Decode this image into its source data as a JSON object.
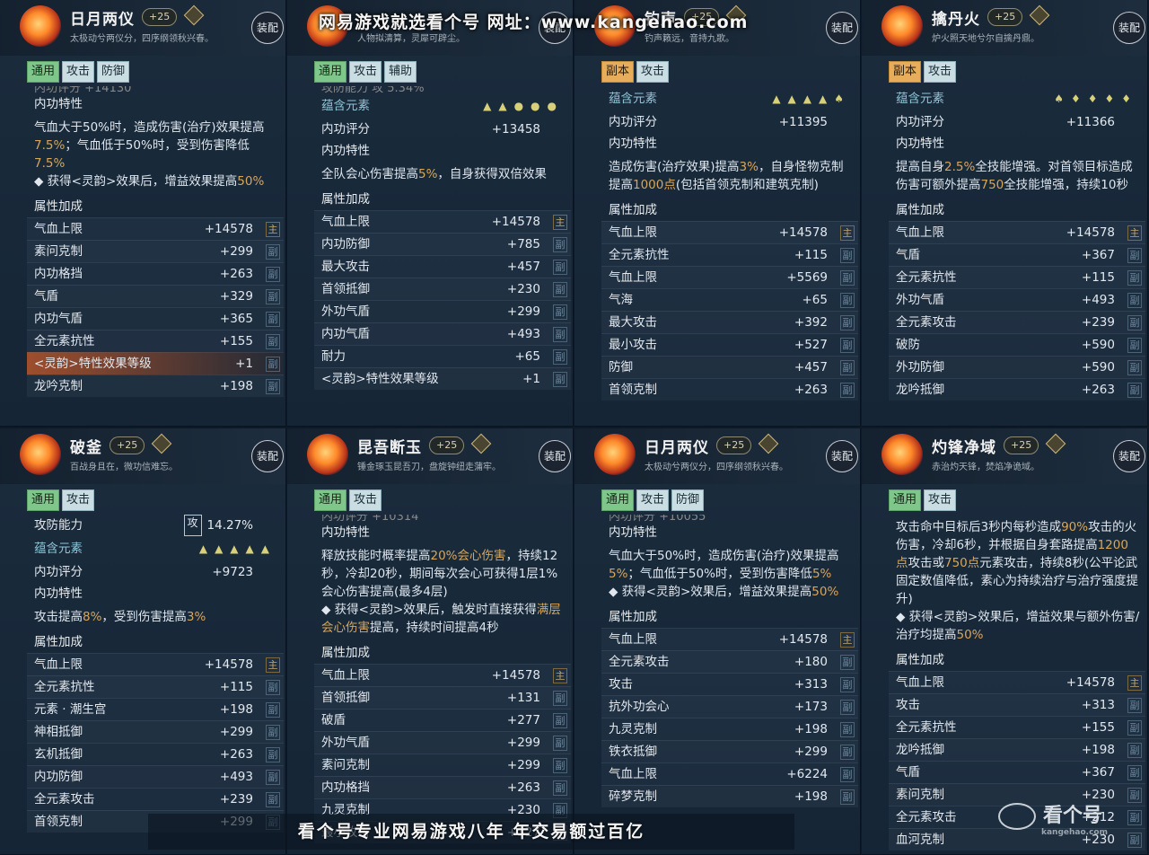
{
  "watermark_top": "网易游戏就选看个号  网址：www.kangehao.com",
  "watermark_bottom": "看个号专业网易游戏八年  年交易额过百亿",
  "watermark_logo": "看个号",
  "watermark_logo_url": "kangehao.com",
  "panels": [
    {
      "name": "日月两仪",
      "level": "+25",
      "desc": "太极动兮两仪分，四序纲领秋兴春。",
      "equip": "装配",
      "tags": [
        [
          "通用",
          "g"
        ],
        [
          "攻击",
          ""
        ],
        [
          "防御",
          ""
        ]
      ],
      "clip": "内功评分                +14130",
      "sections": [
        {
          "t": "sec",
          "k": "内功特性"
        },
        {
          "t": "txt",
          "html": "气血大于50%时，造成伤害(治疗)效果提高<span class='hl'>7.5%</span>；气血低于50%时，受到伤害降低<span class='hl'>7.5%</span><br>◆ 获得&lt;灵韵&gt;效果后，增益效果提高<span class='hl'>50%</span>"
        },
        {
          "t": "sec",
          "k": "属性加成"
        }
      ],
      "attrs": [
        [
          "气血上限",
          "+14578",
          "主"
        ],
        [
          "素问克制",
          "+299",
          "副"
        ],
        [
          "内功格挡",
          "+263",
          "副"
        ],
        [
          "气盾",
          "+329",
          "副"
        ],
        [
          "内功气盾",
          "+365",
          "副"
        ],
        [
          "全元素抗性",
          "+155",
          "副"
        ],
        [
          "<灵韵>特性效果等级",
          "+1",
          "副"
        ],
        [
          "龙吟克制",
          "+198",
          "副"
        ]
      ]
    },
    {
      "name": "",
      "level": "",
      "desc": "人物拟清算，灵犀可辟尘。",
      "equip": "装配",
      "tags": [
        [
          "通用",
          "g"
        ],
        [
          "攻击",
          ""
        ],
        [
          "辅助",
          ""
        ]
      ],
      "clip": "攻防能力           攻 5.34%",
      "elem": {
        "k": "蕴含元素",
        "ic": "▲▲●●●"
      },
      "sections": [
        {
          "t": "row",
          "k": "内功评分",
          "v": "+13458"
        },
        {
          "t": "sec",
          "k": "内功特性"
        },
        {
          "t": "txt",
          "html": "全队会心伤害提高<span class='hl'>5%</span>，自身获得双倍效果"
        },
        {
          "t": "sec",
          "k": "属性加成"
        }
      ],
      "attrs": [
        [
          "气血上限",
          "+14578",
          "主"
        ],
        [
          "内功防御",
          "+785",
          "副"
        ],
        [
          "最大攻击",
          "+457",
          "副"
        ],
        [
          "首领抵御",
          "+230",
          "副"
        ],
        [
          "外功气盾",
          "+299",
          "副"
        ],
        [
          "内功气盾",
          "+493",
          "副"
        ],
        [
          "耐力",
          "+65",
          "副"
        ],
        [
          "<灵韵>特性效果等级",
          "+1",
          "副"
        ]
      ]
    },
    {
      "name": "钓声",
      "level": "+25",
      "desc": "钓声籁远，音持九歌。",
      "equip": "装配",
      "tags": [
        [
          "副本",
          "o"
        ],
        [
          "攻击",
          ""
        ]
      ],
      "clip": "",
      "elem": {
        "k": "蕴含元素",
        "ic": "▲▲▲▲♠"
      },
      "sections": [
        {
          "t": "row",
          "k": "内功评分",
          "v": "+11395"
        },
        {
          "t": "sec",
          "k": "内功特性"
        },
        {
          "t": "txt",
          "html": "造成伤害(治疗效果)提高<span class='hl'>3%</span>，自身怪物克制提高<span class='hl'>1000点</span>(包括首领克制和建筑克制)"
        },
        {
          "t": "sec",
          "k": "属性加成"
        }
      ],
      "attrs": [
        [
          "气血上限",
          "+14578",
          "主"
        ],
        [
          "全元素抗性",
          "+115",
          "副"
        ],
        [
          "气血上限",
          "+5569",
          "副"
        ],
        [
          "气海",
          "+65",
          "副"
        ],
        [
          "最大攻击",
          "+392",
          "副"
        ],
        [
          "最小攻击",
          "+527",
          "副"
        ],
        [
          "防御",
          "+457",
          "副"
        ],
        [
          "首领克制",
          "+263",
          "副"
        ]
      ]
    },
    {
      "name": "擒丹火",
      "level": "+25",
      "desc": "炉火照天地兮尔自擒丹鼎。",
      "equip": "装配",
      "tags": [
        [
          "副本",
          "o"
        ],
        [
          "攻击",
          ""
        ]
      ],
      "clip": "",
      "elem": {
        "k": "蕴含元素",
        "ic": "♠♦♦♦♦"
      },
      "sections": [
        {
          "t": "row",
          "k": "内功评分",
          "v": "+11366"
        },
        {
          "t": "sec",
          "k": "内功特性"
        },
        {
          "t": "txt",
          "html": "提高自身<span class='hl'>2.5%</span>全技能增强。对首领目标造成伤害可额外提高<span class='hl'>750</span>全技能增强，持续10秒"
        },
        {
          "t": "sec",
          "k": "属性加成"
        }
      ],
      "attrs": [
        [
          "气血上限",
          "+14578",
          "主"
        ],
        [
          "气盾",
          "+367",
          "副"
        ],
        [
          "全元素抗性",
          "+115",
          "副"
        ],
        [
          "外功气盾",
          "+493",
          "副"
        ],
        [
          "全元素攻击",
          "+239",
          "副"
        ],
        [
          "破防",
          "+590",
          "副"
        ],
        [
          "外功防御",
          "+590",
          "副"
        ],
        [
          "龙吟抵御",
          "+263",
          "副"
        ]
      ]
    },
    {
      "name": "破釜",
      "level": "+25",
      "desc": "百战身且在，微功信难忘。",
      "equip": "装配",
      "tags": [
        [
          "通用",
          "g"
        ],
        [
          "攻击",
          ""
        ]
      ],
      "clip": "",
      "atk": {
        "k": "攻防能力",
        "badge": "攻",
        "v": "14.27%"
      },
      "elem": {
        "k": "蕴含元素",
        "ic": "▲▲▲▲▲"
      },
      "sections": [
        {
          "t": "row",
          "k": "内功评分",
          "v": "+9723"
        },
        {
          "t": "sec",
          "k": "内功特性"
        },
        {
          "t": "txt",
          "html": "攻击提高<span class='hl'>8%</span>，受到伤害提高<span class='hl'>3%</span>"
        },
        {
          "t": "sec",
          "k": "属性加成"
        }
      ],
      "attrs": [
        [
          "气血上限",
          "+14578",
          "主"
        ],
        [
          "全元素抗性",
          "+115",
          "副"
        ],
        [
          "元素 · 潮生宫",
          "+198",
          "副"
        ],
        [
          "神相抵御",
          "+299",
          "副"
        ],
        [
          "玄机抵御",
          "+263",
          "副"
        ],
        [
          "内功防御",
          "+493",
          "副"
        ],
        [
          "全元素攻击",
          "+239",
          "副"
        ],
        [
          "首领克制",
          "+299",
          "副"
        ]
      ]
    },
    {
      "name": "昆吾断玉",
      "level": "+25",
      "desc": "锤金琢玉昆吾刀，盘旋钟纽走蒲牢。",
      "equip": "装配",
      "tags": [
        [
          "通用",
          "g"
        ],
        [
          "攻击",
          ""
        ]
      ],
      "clip": "内功评分                +10314",
      "sections": [
        {
          "t": "sec",
          "k": "内功特性"
        },
        {
          "t": "txt",
          "html": "释放技能时概率提高<span class='hl'>20%会心伤害</span>，持续12秒，冷却20秒，期间每次会心可获得1层1%会心伤害提高(最多4层)<br>◆ 获得&lt;灵韵&gt;效果后，触发时直接获得<span class='hl'>满层会心伤害</span>提高，持续时间提高4秒"
        },
        {
          "t": "sec",
          "k": "属性加成"
        }
      ],
      "attrs": [
        [
          "气血上限",
          "+14578",
          "主"
        ],
        [
          "首领抵御",
          "+131",
          "副"
        ],
        [
          "破盾",
          "+277",
          "副"
        ],
        [
          "外功气盾",
          "+299",
          "副"
        ],
        [
          "素问克制",
          "+299",
          "副"
        ],
        [
          "内功格挡",
          "+263",
          "副"
        ],
        [
          "九灵克制",
          "+230",
          "副"
        ],
        [
          "最小攻击",
          "+327",
          "副"
        ]
      ]
    },
    {
      "name": "日月两仪",
      "level": "+25",
      "desc": "太极动兮两仪分，四序纲领秋兴春。",
      "equip": "装配",
      "tags": [
        [
          "通用",
          "g"
        ],
        [
          "攻击",
          ""
        ],
        [
          "防御",
          ""
        ]
      ],
      "clip": "内功评分                +10055",
      "sections": [
        {
          "t": "sec",
          "k": "内功特性"
        },
        {
          "t": "txt",
          "html": "气血大于50%时，造成伤害(治疗)效果提高<span class='hl'>5%</span>；气血低于50%时，受到伤害降低<span class='hl'>5%</span><br>◆ 获得&lt;灵韵&gt;效果后，增益效果提高<span class='hl'>50%</span>"
        },
        {
          "t": "sec",
          "k": "属性加成"
        }
      ],
      "attrs": [
        [
          "气血上限",
          "+14578",
          "主"
        ],
        [
          "全元素攻击",
          "+180",
          "副"
        ],
        [
          "攻击",
          "+313",
          "副"
        ],
        [
          "抗外功会心",
          "+173",
          "副"
        ],
        [
          "九灵克制",
          "+198",
          "副"
        ],
        [
          "铁衣抵御",
          "+299",
          "副"
        ],
        [
          "气血上限",
          "+6224",
          "副"
        ],
        [
          "碎梦克制",
          "+198",
          "副"
        ]
      ]
    },
    {
      "name": "灼锋净域",
      "level": "+25",
      "desc": "赤治灼天锋，焚焰净诡域。",
      "equip": "装配",
      "tags": [
        [
          "通用",
          "g"
        ],
        [
          "攻击",
          ""
        ]
      ],
      "clip": "",
      "sections": [
        {
          "t": "txt",
          "html": "攻击命中目标后3秒内每秒造成<span class='hl'>90%</span>攻击的火伤害，冷却6秒，并根据自身套路提高<span class='hl'>1200点</span>攻击或<span class='hl'>750点</span>元素攻击，持续8秒(公平论武固定数值降低，素心为持续治疗与治疗强度提升)<br>◆ 获得&lt;灵韵&gt;效果后，增益效果与额外伤害/治疗均提高<span class='hl'>50%</span>"
        },
        {
          "t": "sec",
          "k": "属性加成"
        }
      ],
      "attrs": [
        [
          "气血上限",
          "+14578",
          "主"
        ],
        [
          "攻击",
          "+313",
          "副"
        ],
        [
          "全元素抗性",
          "+155",
          "副"
        ],
        [
          "龙吟抵御",
          "+198",
          "副"
        ],
        [
          "气盾",
          "+367",
          "副"
        ],
        [
          "素问克制",
          "+230",
          "副"
        ],
        [
          "全元素攻击",
          "+212",
          "副"
        ],
        [
          "血河克制",
          "+230",
          "副"
        ]
      ]
    }
  ]
}
